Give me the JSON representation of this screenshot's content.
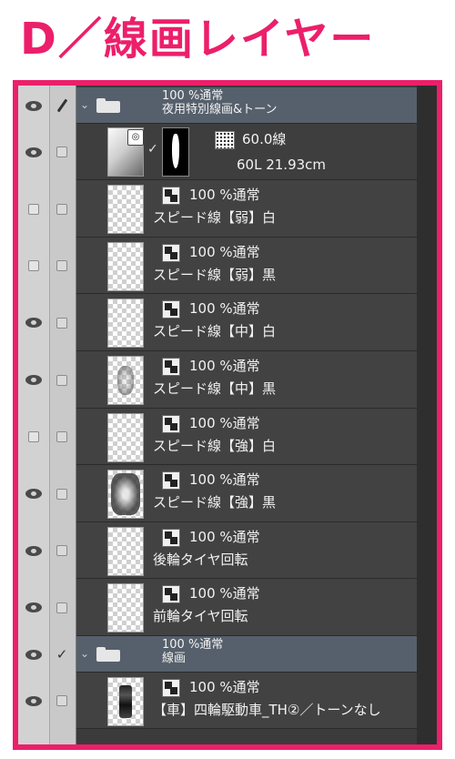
{
  "page_title": "D／線画レイヤー",
  "colors": {
    "accent": "#ec1f6a",
    "panel": "#424242",
    "folder": "#56606c"
  },
  "layers": [
    {
      "type": "folder",
      "opacity": "100 %通常",
      "name": "夜用特別線画&トーン",
      "eye": true,
      "lock": "pen"
    },
    {
      "type": "ruler",
      "tone": "60.0線",
      "info": "60L 21.93cm",
      "eye": true,
      "lock": "box"
    },
    {
      "type": "layer",
      "opacity": "100 %通常",
      "name": "スピード線【弱】白",
      "eye": false,
      "lock": "box",
      "thumb": "light"
    },
    {
      "type": "layer",
      "opacity": "100 %通常",
      "name": "スピード線【弱】黒",
      "eye": false,
      "lock": "box",
      "thumb": "light"
    },
    {
      "type": "layer",
      "opacity": "100 %通常",
      "name": "スピード線【中】白",
      "eye": true,
      "lock": "box",
      "thumb": "light"
    },
    {
      "type": "layer",
      "opacity": "100 %通常",
      "name": "スピード線【中】黒",
      "eye": true,
      "lock": "box",
      "thumb": "mid"
    },
    {
      "type": "layer",
      "opacity": "100 %通常",
      "name": "スピード線【強】白",
      "eye": false,
      "lock": "box",
      "thumb": "light"
    },
    {
      "type": "layer",
      "opacity": "100 %通常",
      "name": "スピード線【強】黒",
      "eye": true,
      "lock": "box",
      "thumb": "dark"
    },
    {
      "type": "layer",
      "opacity": "100 %通常",
      "name": "後輪タイヤ回転",
      "eye": true,
      "lock": "box",
      "thumb": "light"
    },
    {
      "type": "layer",
      "opacity": "100 %通常",
      "name": "前輪タイヤ回転",
      "eye": true,
      "lock": "box",
      "thumb": "light"
    },
    {
      "type": "folder",
      "opacity": "100 %通常",
      "name": "線画",
      "eye": true,
      "lock": "check"
    },
    {
      "type": "layer",
      "opacity": "100 %通常",
      "name": "【車】四輪駆動車_TH②／トーンなし",
      "eye": true,
      "lock": "box",
      "thumb": "car"
    }
  ]
}
